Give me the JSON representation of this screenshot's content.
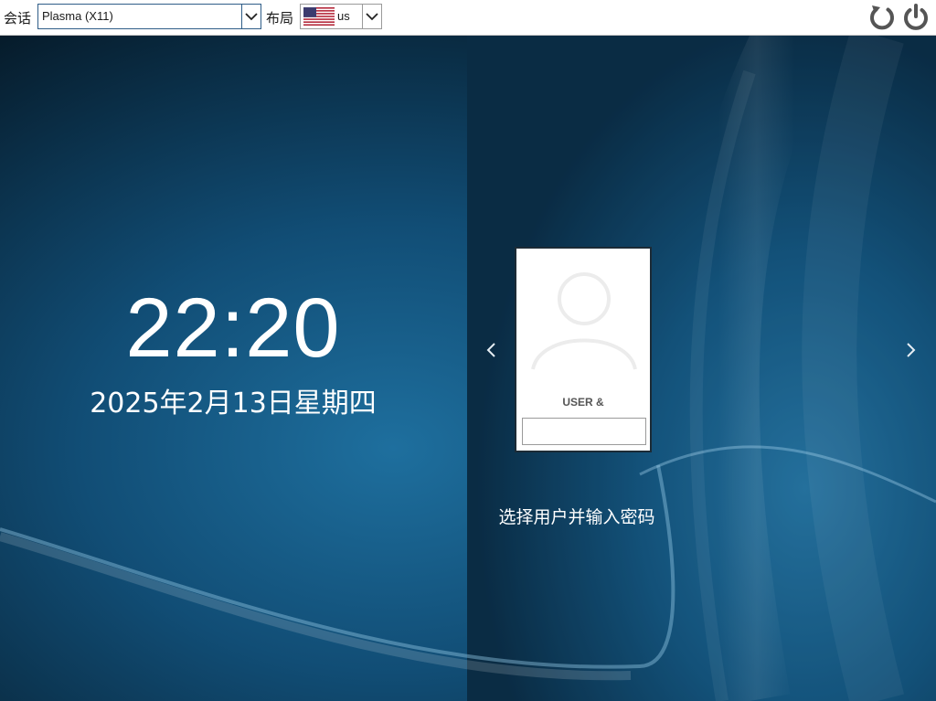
{
  "topbar": {
    "session_label": "会话",
    "session_value": "Plasma (X11)",
    "layout_label": "布局",
    "layout_value": "us"
  },
  "clock": {
    "time": "22:20",
    "date": "2025年2月13日星期四"
  },
  "user_card": {
    "user_name": "USER &",
    "password_value": ""
  },
  "prompt": "选择用户并输入密码",
  "icons": {
    "reboot": "reboot-icon",
    "shutdown": "power-icon",
    "prev": "chevron-left-icon",
    "next": "chevron-right-icon",
    "flag": "us-flag-icon",
    "avatar": "user-avatar-icon"
  },
  "colors": {
    "background": "#0d3553",
    "panel": "#0b3250",
    "text": "#ffffff",
    "combo_border": "#2f5d88"
  }
}
